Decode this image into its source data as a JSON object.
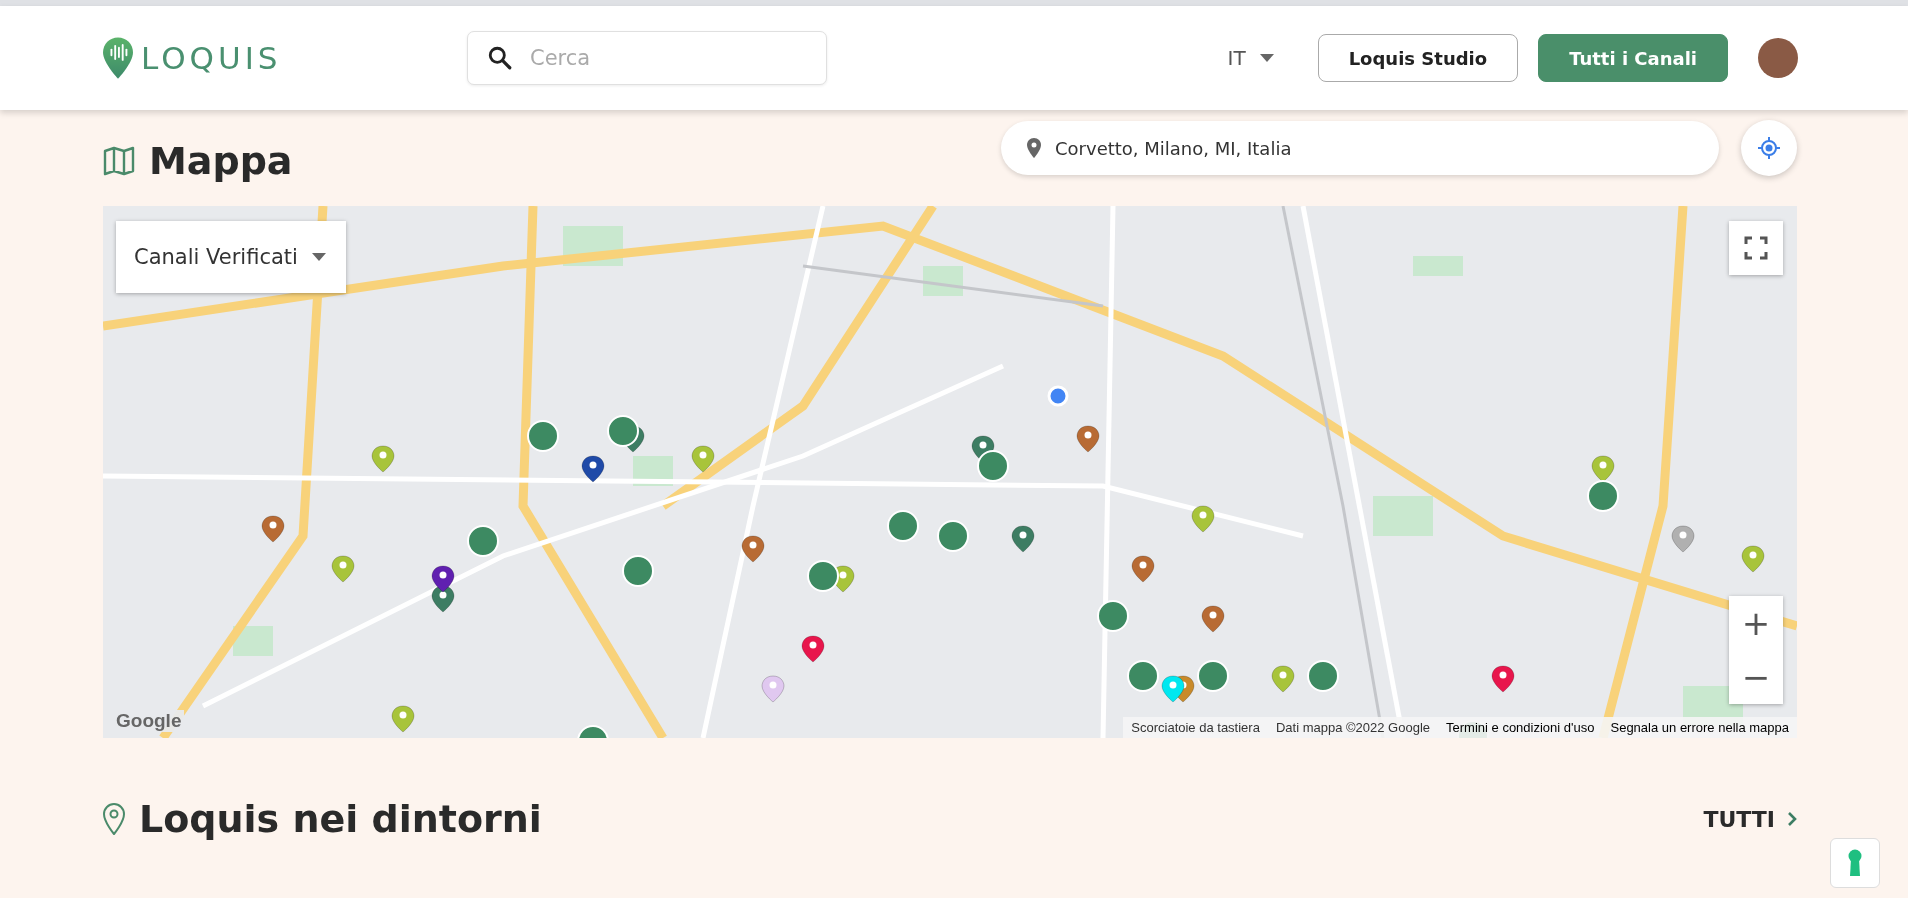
{
  "header": {
    "logo": "LOQUIS",
    "search": {
      "placeholder": "Cerca"
    },
    "language": "IT",
    "buttons": [
      {
        "kind": "outline",
        "label": "Loquis Studio"
      },
      {
        "kind": "primary",
        "label": "Tutti i Canali"
      }
    ]
  },
  "map_section": {
    "title": "Mappa",
    "location": "Corvetto, Milano, MI, Italia",
    "map": {
      "filter": "Canali Verificati",
      "zoom_in": "+",
      "zoom_out": "−",
      "google": "Google",
      "attribution": [
        {
          "kind": "plain",
          "text": "Scorciatoie da tastiera"
        },
        {
          "kind": "plain",
          "text": "Dati mappa ©2022 Google"
        },
        {
          "kind": "link",
          "text": "Termini e condizioni d'uso"
        },
        {
          "kind": "link",
          "text": "Segnala un errore nella mappa"
        }
      ]
    }
  },
  "nearby_section": {
    "title": "Loquis nei dintorni",
    "more": "TUTTI"
  }
}
